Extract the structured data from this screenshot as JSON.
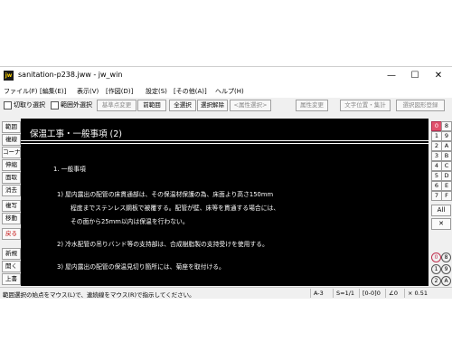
{
  "window": {
    "icon_text": "jw",
    "title": "sanitation-p238.jww - jw_win",
    "minimize": "—",
    "maximize": "☐",
    "close": "✕"
  },
  "menu": [
    "ファイル(F)",
    "[編集(E)]",
    "表示(V)",
    "[作図(D)]",
    "設定(S)",
    "[その他(A)]",
    "ヘルプ(H)"
  ],
  "toolbar": {
    "checkbox1": "切取り選択",
    "checkbox2": "範囲外選択",
    "btn_base": "基準点変更",
    "btn_prev": "前範囲",
    "btn_all": "全選択",
    "btn_release": "選択解除",
    "btn_attr_select": "<属性選択>",
    "btn_attr_change": "属性変更",
    "btn_text_pos": "文字位置・集計",
    "btn_register": "選択図形登録"
  },
  "left_tools": [
    "範囲",
    "複線",
    "コーナー",
    "伸縮",
    "面取",
    "消去",
    "複写",
    "移動",
    "戻る",
    "新規",
    "開く",
    "上書"
  ],
  "right_layers": {
    "rows": [
      [
        "0",
        "8"
      ],
      [
        "1",
        "9"
      ],
      [
        "2",
        "A"
      ],
      [
        "3",
        "B"
      ],
      [
        "4",
        "C"
      ],
      [
        "5",
        "D"
      ],
      [
        "6",
        "E"
      ],
      [
        "7",
        "F"
      ]
    ],
    "all_label": "All",
    "x_label": "✕",
    "circles": [
      [
        "0",
        "8"
      ],
      [
        "1",
        "9"
      ],
      [
        "2",
        "A"
      ]
    ]
  },
  "drawing": {
    "title": "保温工事・一般事項 (2)",
    "section1": "1. 一般事項",
    "item1_l1": "1) 屋内露出の配管の床貫通部は、その保温材保護の為、床面より高さ150mm",
    "item1_l2": "程度までステンレス鋼板で被覆する。配管が壁、床等を貫通する場合には、",
    "item1_l3": "その面から25mm以内は保温を行わない。",
    "item2": "2) 冷水配管の吊りバンド等の支持部は、合成樹脂製の支持受けを使用する。",
    "item3": "3) 屋内露出の配管の保温見切り箇所には、菊座を取付ける。"
  },
  "status": {
    "message": "範囲選択の始点をマウス(L)で、連続線をマウス(R)で指示してください。",
    "paper": "A-3",
    "scale": "S=1/1",
    "layer": "[0-0]0",
    "angle": "∠0",
    "zoom": "× 0.51"
  }
}
